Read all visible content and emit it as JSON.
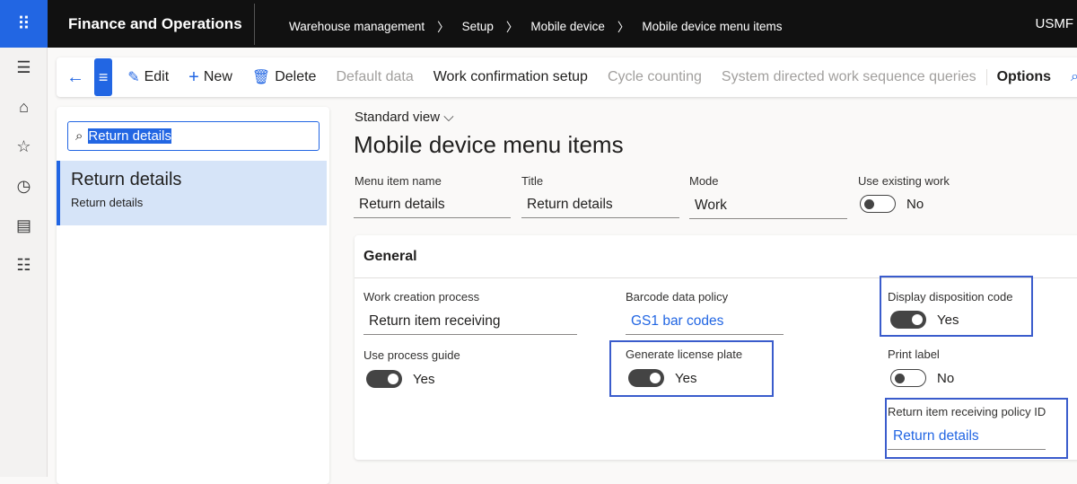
{
  "header": {
    "app_title": "Finance and Operations",
    "breadcrumbs": [
      "Warehouse management",
      "Setup",
      "Mobile device",
      "Mobile device menu items"
    ],
    "company": "USMF"
  },
  "toolbar": {
    "edit": "Edit",
    "new": "New",
    "delete": "Delete",
    "default_data": "Default data",
    "work_confirmation": "Work confirmation setup",
    "cycle_counting": "Cycle counting",
    "sdwsq": "System directed work sequence queries",
    "options": "Options"
  },
  "list": {
    "search_value": "Return details",
    "items": [
      {
        "title": "Return details",
        "subtitle": "Return details"
      }
    ]
  },
  "page": {
    "view": "Standard view",
    "title": "Mobile device menu items"
  },
  "fields": {
    "menu_item_name_label": "Menu item name",
    "menu_item_name": "Return details",
    "title_label": "Title",
    "title": "Return details",
    "mode_label": "Mode",
    "mode": "Work",
    "use_existing_label": "Use existing work",
    "use_existing": "No"
  },
  "general": {
    "heading": "General",
    "work_creation_label": "Work creation process",
    "work_creation": "Return item receiving",
    "use_guide_label": "Use process guide",
    "use_guide": "Yes",
    "barcode_label": "Barcode data policy",
    "barcode": "GS1 bar codes",
    "gen_lp_label": "Generate license plate",
    "gen_lp": "Yes",
    "disp_label": "Display disposition code",
    "disp": "Yes",
    "print_label": "Print label",
    "print": "No",
    "policy_label": "Return item receiving policy ID",
    "policy": "Return details"
  },
  "colors": {
    "accent": "#2266e3",
    "highlight": "#3a5ccc"
  }
}
